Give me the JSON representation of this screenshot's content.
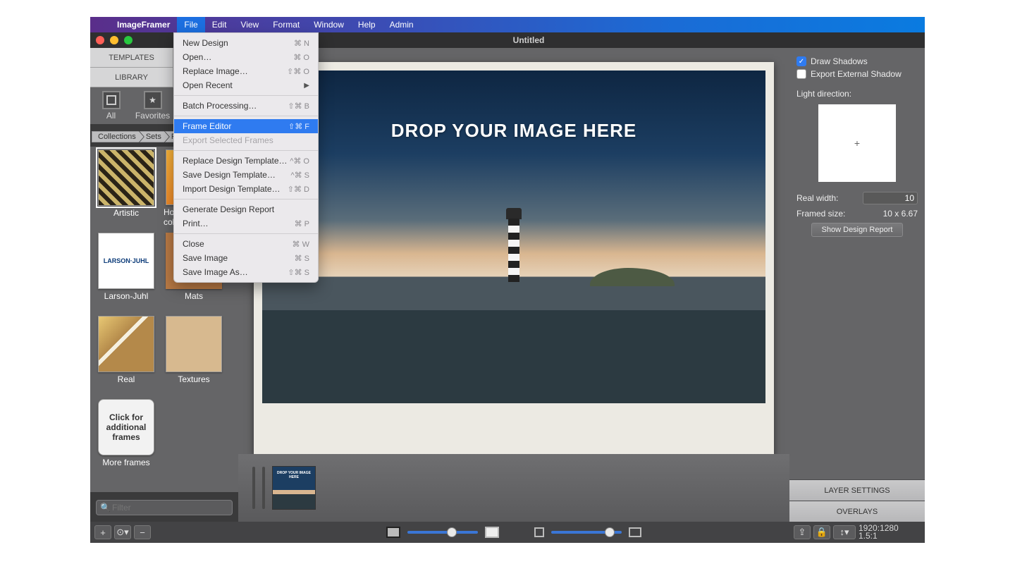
{
  "menubar": {
    "app": "ImageFramer",
    "items": [
      "File",
      "Edit",
      "View",
      "Format",
      "Window",
      "Help",
      "Admin"
    ],
    "open_index": 0
  },
  "window": {
    "title": "Untitled"
  },
  "left_tabs": [
    "TEMPLATES",
    "LIBRARY"
  ],
  "toolbar": {
    "all": "All",
    "favorites": "Favorites"
  },
  "breadcrumbs": [
    "Collections",
    "Sets",
    "F"
  ],
  "frames": [
    {
      "label": "Artistic",
      "cls": "artistic",
      "sel": true
    },
    {
      "label": "Holiday collection",
      "cls": "holiday"
    },
    {
      "label": "Larson-Juhl",
      "cls": "larson",
      "text": "LARSON·JUHL"
    },
    {
      "label": "Mats",
      "cls": "mats"
    },
    {
      "label": "Real",
      "cls": "real"
    },
    {
      "label": "Textures",
      "cls": "textures"
    },
    {
      "label": "More frames",
      "cls": "more",
      "text": "Click for additional frames"
    }
  ],
  "filter": {
    "placeholder": "Filter"
  },
  "canvas": {
    "drop": "DROP YOUR IMAGE HERE"
  },
  "right": {
    "draw_shadows": "Draw Shadows",
    "export_ext": "Export External Shadow",
    "light_dir": "Light direction:",
    "real_width_label": "Real width:",
    "real_width": "10",
    "framed_label": "Framed size:",
    "framed": "10 x 6.67",
    "show_report": "Show Design Report",
    "layer": "LAYER SETTINGS",
    "overlays": "OVERLAYS"
  },
  "status": {
    "dims": "1920:1280",
    "ratio": "1.5:1"
  },
  "menu_file": [
    {
      "label": "New Design",
      "sc": "⌘ N"
    },
    {
      "label": "Open…",
      "sc": "⌘ O"
    },
    {
      "label": "Replace Image…",
      "sc": "⇧⌘ O"
    },
    {
      "label": "Open Recent",
      "submenu": true
    },
    {
      "sep": true
    },
    {
      "label": "Batch Processing…",
      "sc": "⇧⌘ B"
    },
    {
      "sep": true
    },
    {
      "label": "Frame Editor",
      "sc": "⇧⌘ F",
      "selected": true
    },
    {
      "label": "Export Selected Frames",
      "disabled": true
    },
    {
      "sep": true
    },
    {
      "label": "Replace Design Template…",
      "sc": "^⌘ O"
    },
    {
      "label": "Save Design Template…",
      "sc": "^⌘ S"
    },
    {
      "label": "Import Design Template…",
      "sc": "⇧⌘ D"
    },
    {
      "sep": true
    },
    {
      "label": "Generate Design Report"
    },
    {
      "label": "Print…",
      "sc": "⌘ P"
    },
    {
      "sep": true
    },
    {
      "label": "Close",
      "sc": "⌘ W"
    },
    {
      "label": "Save Image",
      "sc": "⌘ S"
    },
    {
      "label": "Save Image As…",
      "sc": "⇧⌘ S"
    }
  ]
}
